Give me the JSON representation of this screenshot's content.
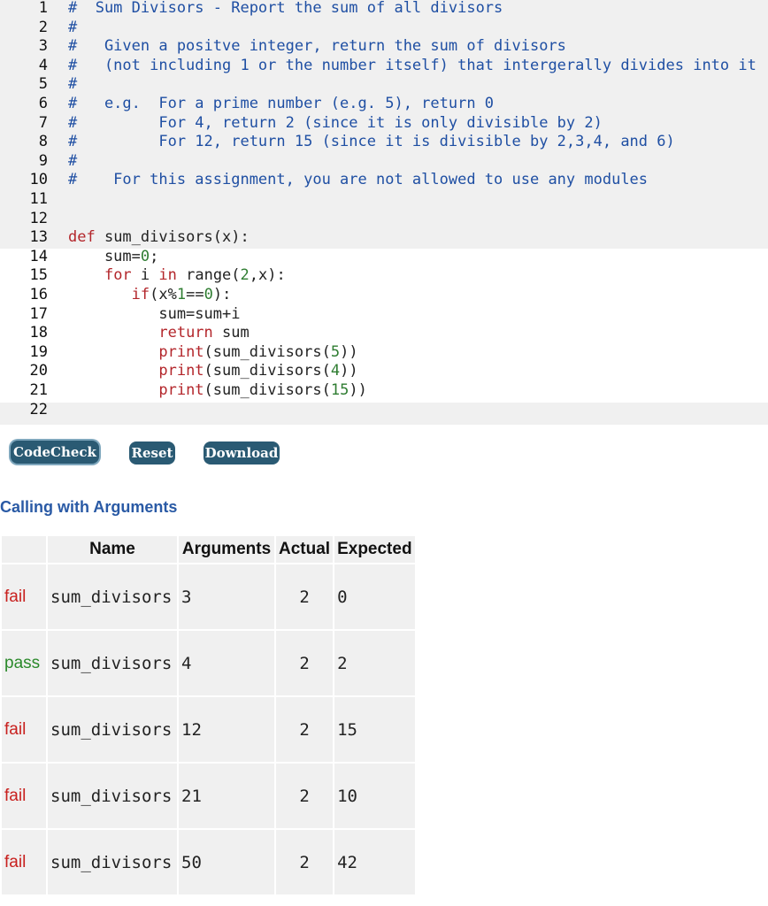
{
  "editor": {
    "lines": [
      {
        "n": "1",
        "t": "#  Sum Divisors - Report the sum of all divisors",
        "cls": "c-comment"
      },
      {
        "n": "2",
        "t": "#",
        "cls": "c-comment"
      },
      {
        "n": "3",
        "t": "#   Given a positve integer, return the sum of divisors",
        "cls": "c-comment"
      },
      {
        "n": "4",
        "t": "#   (not including 1 or the number itself) that intergerally divides into it",
        "cls": "c-comment"
      },
      {
        "n": "5",
        "t": "#",
        "cls": "c-comment"
      },
      {
        "n": "6",
        "t": "#   e.g.  For a prime number (e.g. 5), return 0",
        "cls": "c-comment"
      },
      {
        "n": "7",
        "t": "#         For 4, return 2 (since it is only divisible by 2)",
        "cls": "c-comment"
      },
      {
        "n": "8",
        "t": "#         For 12, return 15 (since it is divisible by 2,3,4, and 6)",
        "cls": "c-comment"
      },
      {
        "n": "9",
        "t": "#",
        "cls": "c-comment"
      },
      {
        "n": "10",
        "t": "#    For this assignment, you are not allowed to use any modules",
        "cls": "c-comment"
      },
      {
        "n": "11",
        "t": "",
        "cls": "c-plain"
      },
      {
        "n": "12",
        "t": "",
        "cls": "c-plain"
      },
      {
        "n": "13",
        "t": "def sum_divisors(x):",
        "cls": "c-plain"
      },
      {
        "n": "14",
        "t": "    sum=0;",
        "cls": "c-plain"
      },
      {
        "n": "15",
        "t": "    for i in range(2,x):",
        "cls": "c-plain"
      },
      {
        "n": "16",
        "t": "       if(x%1==0):",
        "cls": "c-plain"
      },
      {
        "n": "17",
        "t": "          sum=sum+i",
        "cls": "c-plain"
      },
      {
        "n": "18",
        "t": "          return sum",
        "cls": "c-plain"
      },
      {
        "n": "19",
        "t": "          print(sum_divisors(5))",
        "cls": "c-plain"
      },
      {
        "n": "20",
        "t": "          print(sum_divisors(4))",
        "cls": "c-plain"
      },
      {
        "n": "21",
        "t": "          print(sum_divisors(15))",
        "cls": "c-plain"
      },
      {
        "n": "22",
        "t": "",
        "cls": "c-plain"
      }
    ]
  },
  "buttons": {
    "codecheck": "CodeCheck",
    "reset": "Reset",
    "download": "Download"
  },
  "results": {
    "title": "Calling with Arguments",
    "headers": {
      "name": "Name",
      "arguments": "Arguments",
      "actual": "Actual",
      "expected": "Expected"
    },
    "rows": [
      {
        "status": "fail",
        "name": "sum_divisors",
        "args": "3",
        "actual": "2",
        "expected": "0"
      },
      {
        "status": "pass",
        "name": "sum_divisors",
        "args": "4",
        "actual": "2",
        "expected": "2"
      },
      {
        "status": "fail",
        "name": "sum_divisors",
        "args": "12",
        "actual": "2",
        "expected": "15"
      },
      {
        "status": "fail",
        "name": "sum_divisors",
        "args": "21",
        "actual": "2",
        "expected": "10"
      },
      {
        "status": "fail",
        "name": "sum_divisors",
        "args": "50",
        "actual": "2",
        "expected": "42"
      }
    ]
  },
  "colors": {
    "accent": "#2a5a73",
    "heading": "#2a5aa5",
    "fail": "#c8201e",
    "pass": "#2c8a2c",
    "comment": "#1f4fa3",
    "keyword": "#b3262b",
    "number": "#2f7d32"
  }
}
